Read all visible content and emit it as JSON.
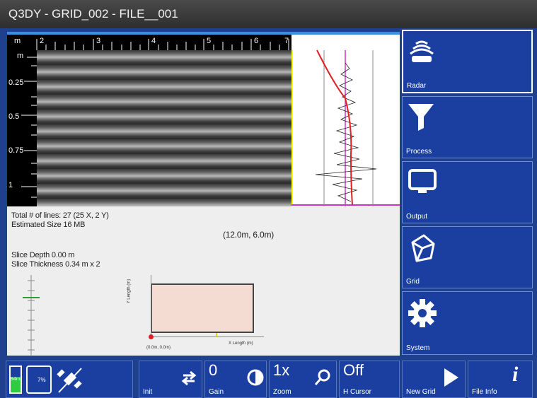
{
  "window": {
    "title": "Q3DY - GRID_002 - FILE__001"
  },
  "radargram": {
    "unit": "m",
    "x_ticks": [
      "2",
      "3",
      "4",
      "5",
      "6",
      "7"
    ],
    "depth_unit": "m",
    "depth_ticks": [
      "0.25",
      "0.5",
      "0.75",
      "1"
    ]
  },
  "info": {
    "total_lines": "Total # of lines: 27 (25 X, 2 Y)",
    "estimated_size": "Estimated Size 16 MB",
    "coordinates": "(12.0m, 6.0m)",
    "slice_depth": "Slice Depth 0.00 m",
    "slice_thickness": "Slice Thickness 0.34 m x 2",
    "grid_origin": "(0.0m, 0.0m)",
    "grid_length_x": "X Length (m)",
    "grid_length_y": "Y Length (m)"
  },
  "sidebar": {
    "items": [
      {
        "label": "Radar",
        "icon": "radar-icon"
      },
      {
        "label": "Process",
        "icon": "filter-icon"
      },
      {
        "label": "Output",
        "icon": "monitor-icon"
      },
      {
        "label": "Grid",
        "icon": "cube-icon"
      },
      {
        "label": "System",
        "icon": "gear-icon"
      }
    ]
  },
  "status": {
    "battery": "94m",
    "device_battery": "7%"
  },
  "bottombar": {
    "init_label": "Init",
    "gain_value": "0",
    "gain_label": "Gain",
    "zoom_value": "1x",
    "zoom_label": "Zoom",
    "hcursor_value": "Off",
    "hcursor_label": "H Cursor",
    "newgrid_label": "New Grid",
    "fileinfo_label": "File Info"
  },
  "colors": {
    "accent": "#1a3fa0",
    "background": "#1f3f8f",
    "trace_line": "#e02020",
    "trace_marker": "#cc33cc",
    "origin_marker": "#e02020",
    "cursor": "#ffff00"
  }
}
